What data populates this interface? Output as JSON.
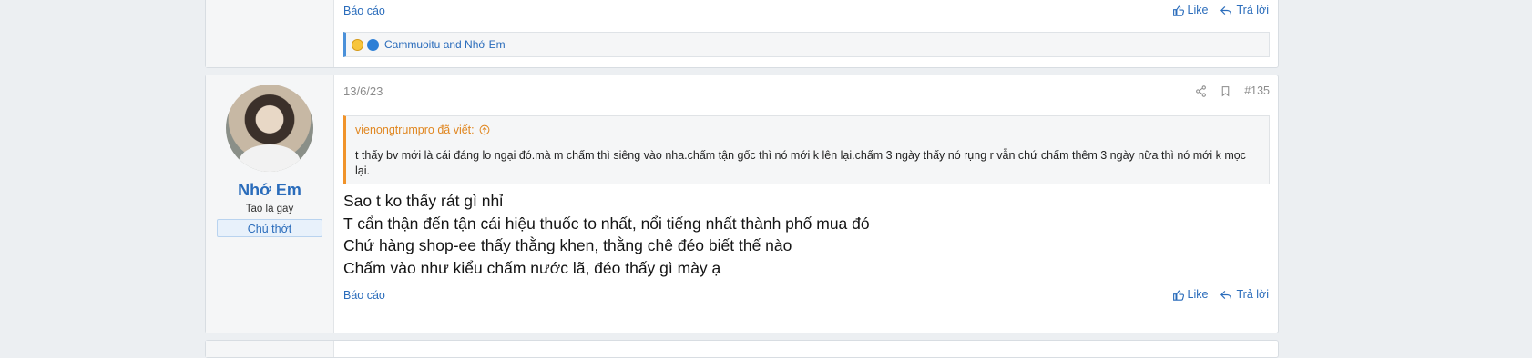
{
  "prev_post": {
    "report_label": "Báo cáo",
    "like_label": "Like",
    "reply_label": "Trả lời",
    "reactions_text": "Cammuoitu and Nhớ Em"
  },
  "post": {
    "user": {
      "name": "Nhớ Em",
      "title": "Tao là gay",
      "banner": "Chủ thớt"
    },
    "date": "13/6/23",
    "post_number": "#135",
    "quote": {
      "author_line": "vienongtrumpro đã viết:",
      "text": "t thấy bv mới là cái đáng lo ngại đó.mà m chấm thì siêng vào nha.chấm tận gốc thì nó mới k lên lại.chấm 3 ngày thấy nó rụng r vẫn chứ chấm thêm 3 ngày nữa thì nó mới k mọc lại."
    },
    "message_lines": [
      "Sao t ko thấy rát gì nhỉ",
      "T cẩn thận đến tận cái hiệu thuốc to nhất, nổi tiếng nhất thành phố mua đó",
      "Chứ hàng shop-ee thấy thằng khen, thằng chê đéo biết thế nào",
      "Chấm vào như kiểu chấm nước lã, đéo thấy gì mày ạ"
    ],
    "report_label": "Báo cáo",
    "like_label": "Like",
    "reply_label": "Trả lời"
  },
  "colors": {
    "link": "#2a6cbb",
    "quote_accent": "#f0932a",
    "background": "#eceff2"
  }
}
